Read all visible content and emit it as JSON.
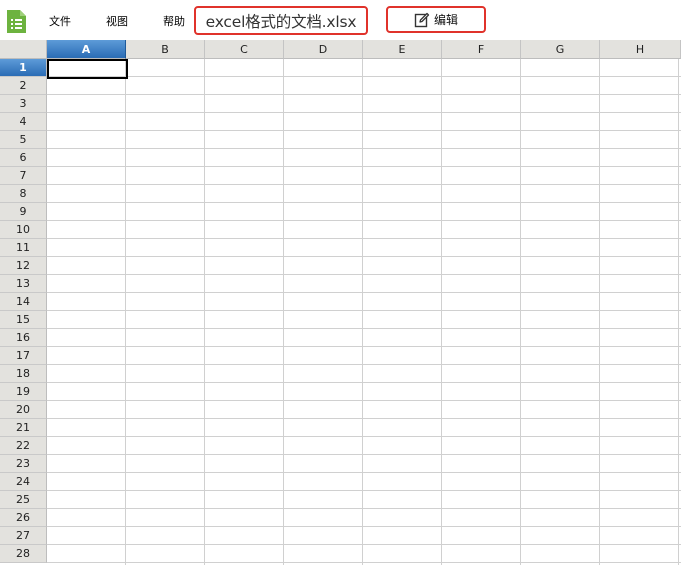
{
  "toolbar": {
    "app_icon": "spreadsheet-app-icon",
    "menu": [
      {
        "label": "文件"
      },
      {
        "label": "视图"
      },
      {
        "label": "帮助"
      }
    ],
    "document_title": "excel格式的文档.xlsx",
    "edit_button": {
      "label": "编辑",
      "icon": "edit-icon"
    },
    "highlight_color": "#e0322b"
  },
  "sheet": {
    "columns": [
      "A",
      "B",
      "C",
      "D",
      "E",
      "F",
      "G",
      "H"
    ],
    "rows": [
      "1",
      "2",
      "3",
      "4",
      "5",
      "6",
      "7",
      "8",
      "9",
      "10",
      "11",
      "12",
      "13",
      "14",
      "15",
      "16",
      "17",
      "18",
      "19",
      "20",
      "21",
      "22",
      "23",
      "24",
      "25",
      "26",
      "27",
      "28"
    ],
    "active_cell": {
      "column": "A",
      "row": "1"
    },
    "accent_color": "#2a6cb5"
  }
}
